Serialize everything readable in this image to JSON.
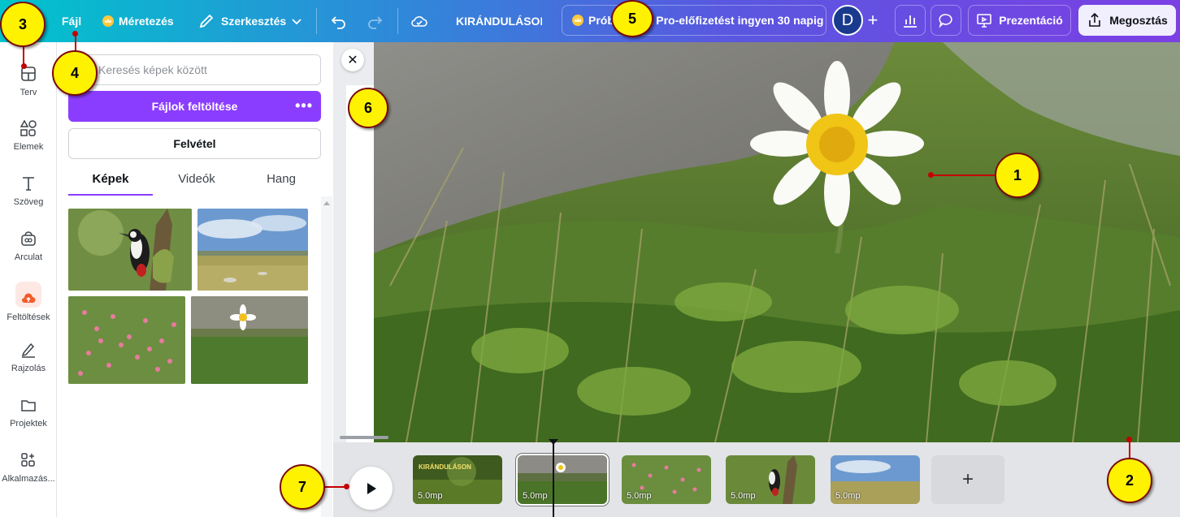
{
  "topbar": {
    "file": "Fájl",
    "resize": "Méretezés",
    "edit": "Szerkesztés",
    "doc_title": "KIRÁNDULÁSON",
    "promo": "Próbáld ki a Pro-előfizetést ingyen 30 napig",
    "avatar_letter": "D",
    "add": "+",
    "present": "Prezentáció",
    "share": "Megosztás"
  },
  "rail": {
    "items": [
      {
        "label": "Terv"
      },
      {
        "label": "Elemek"
      },
      {
        "label": "Szöveg"
      },
      {
        "label": "Arculat"
      },
      {
        "label": "Feltöltések"
      },
      {
        "label": "Rajzolás"
      },
      {
        "label": "Projektek"
      },
      {
        "label": "Alkalmazás..."
      }
    ]
  },
  "panel": {
    "search_placeholder": "Keresés képek között",
    "upload": "Fájlok feltöltése",
    "more": "•••",
    "record": "Felvétel",
    "tabs": [
      "Képek",
      "Videók",
      "Hang"
    ]
  },
  "timeline": {
    "add": "+",
    "clips": [
      {
        "duration": "5.0mp",
        "title": "KIRÁNDULÁSON"
      },
      {
        "duration": "5.0mp"
      },
      {
        "duration": "5.0mp"
      },
      {
        "duration": "5.0mp"
      },
      {
        "duration": "5.0mp"
      }
    ]
  },
  "canvas": {
    "close": "✕"
  },
  "callouts": [
    "1",
    "2",
    "3",
    "4",
    "5",
    "6",
    "7"
  ],
  "colors": {
    "accent": "#8b3dff",
    "callout_fill": "#fff200",
    "callout_line": "#c40000"
  }
}
